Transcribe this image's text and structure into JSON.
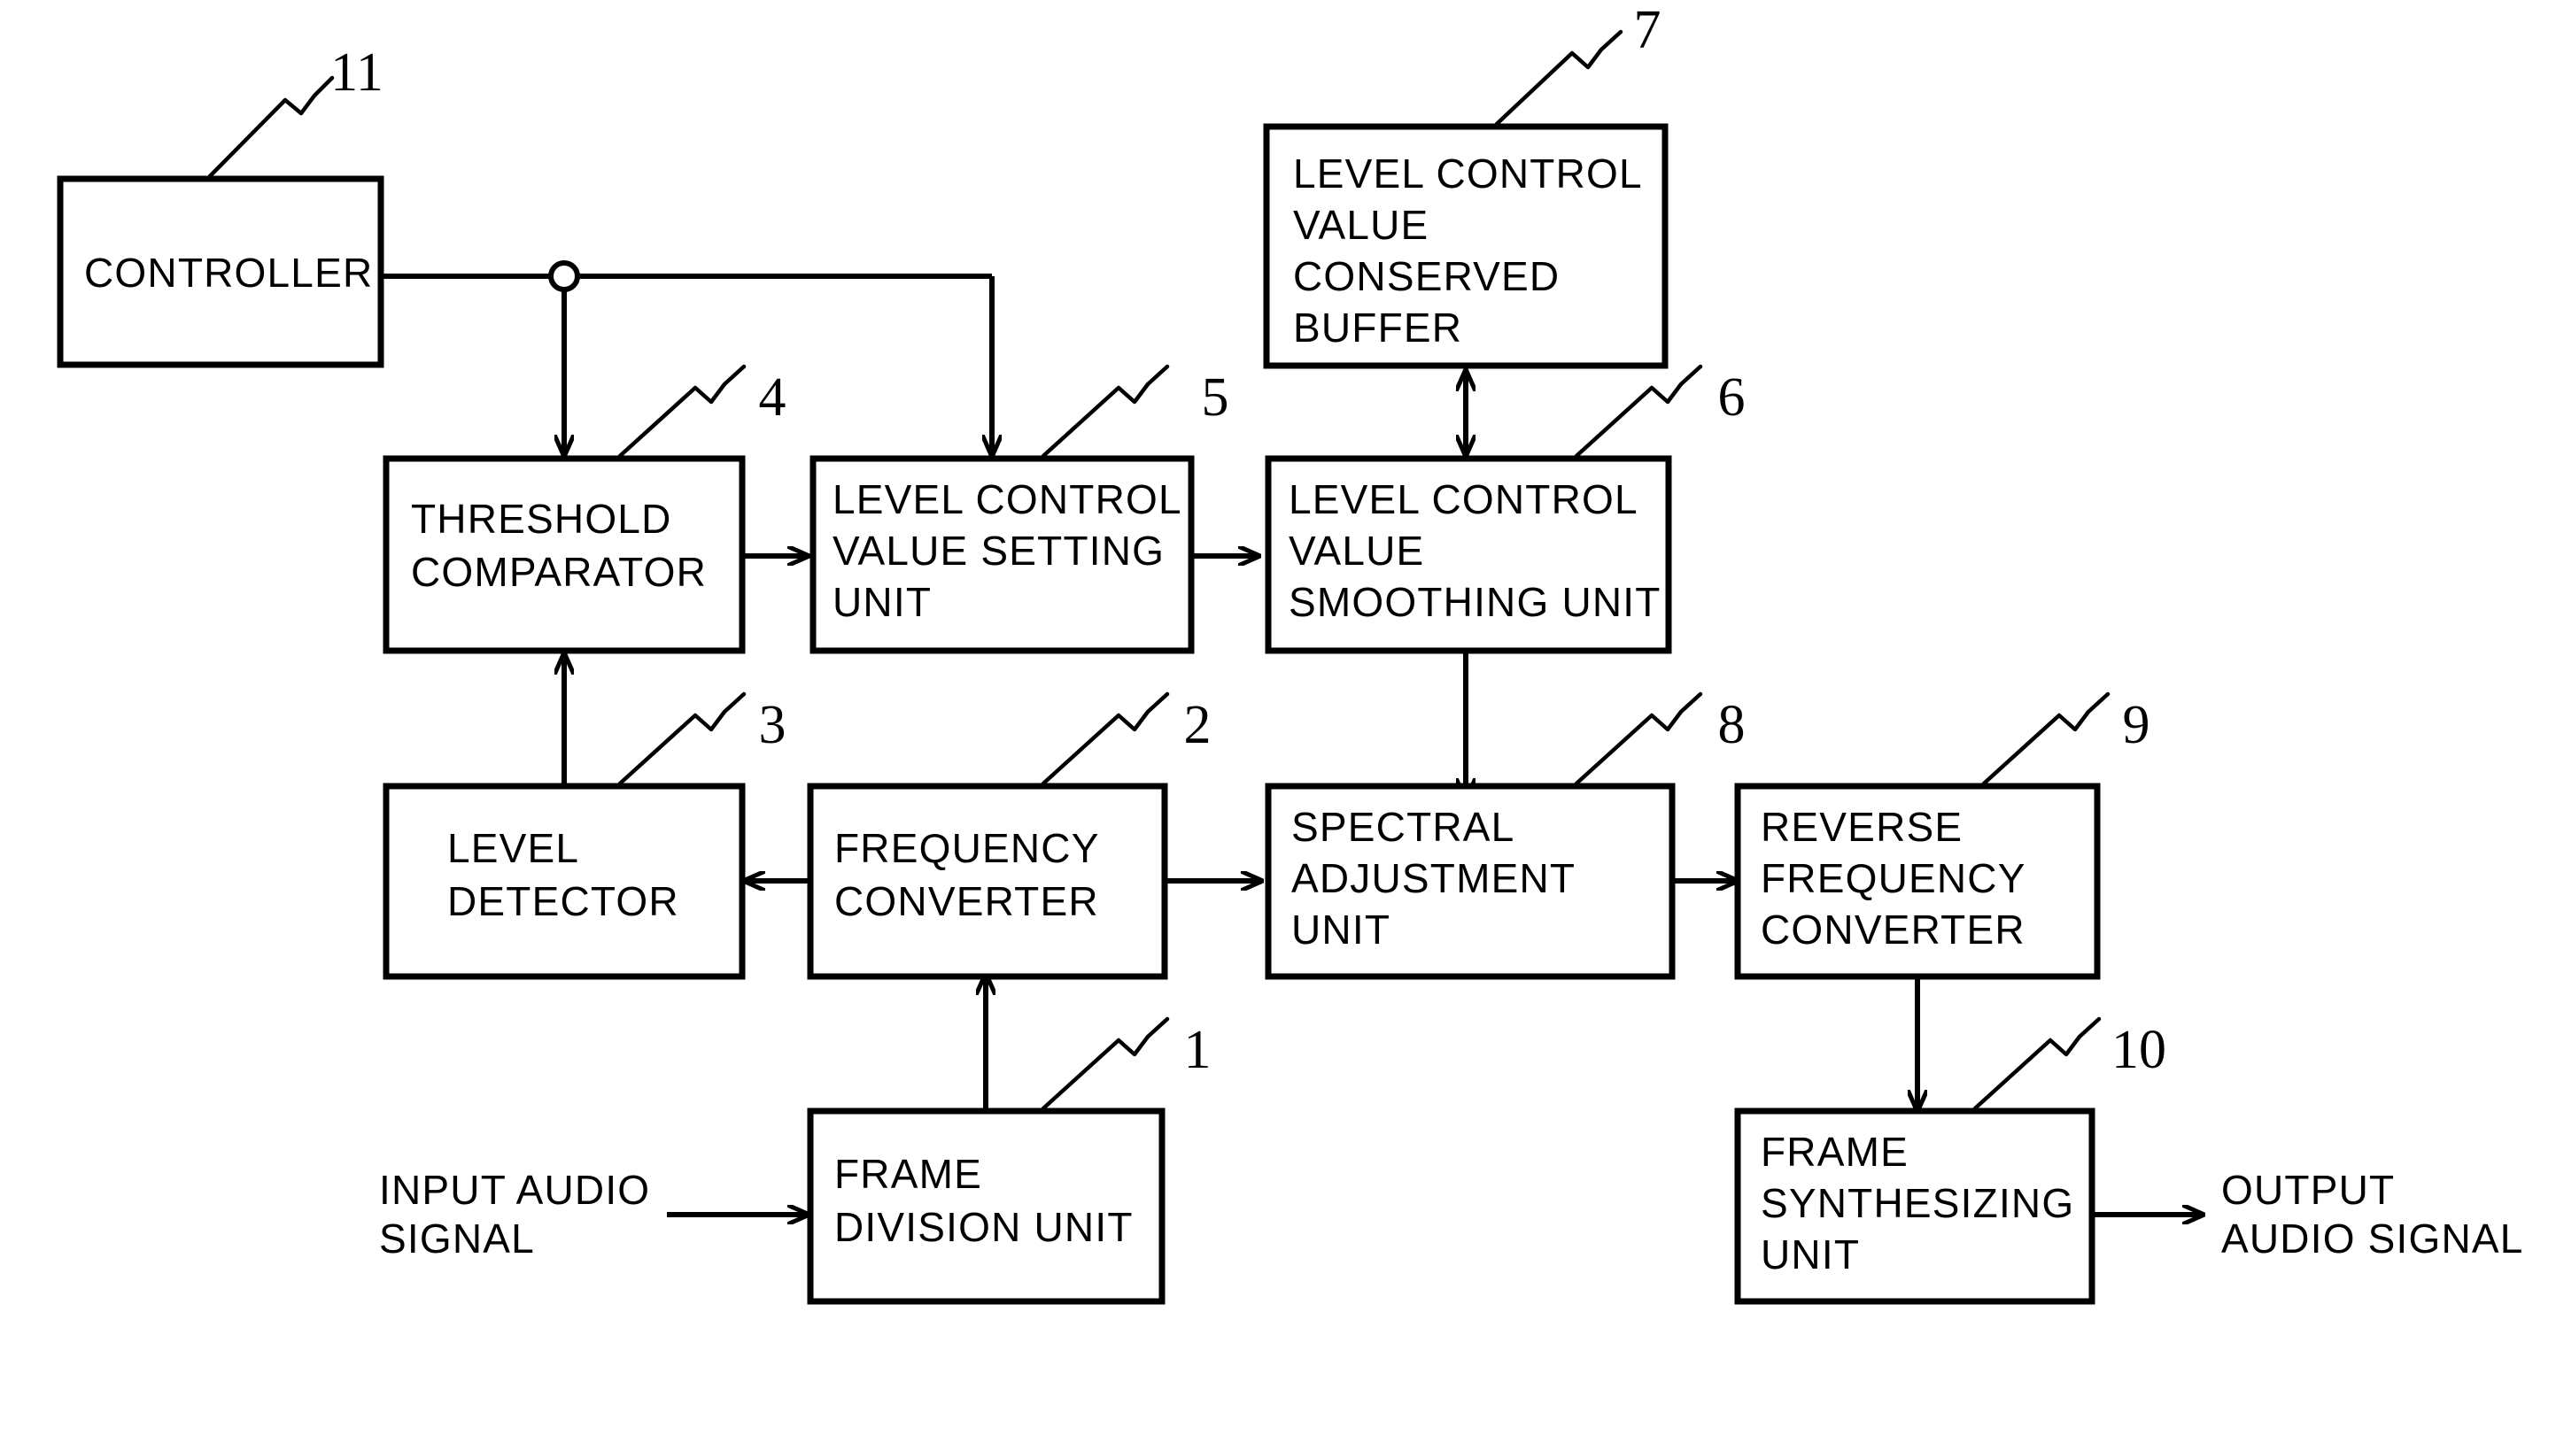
{
  "figure": {
    "kind": "patent-block-diagram",
    "stroke_color": "#000000",
    "fill_color": "#ffffff",
    "background": "#ffffff"
  },
  "blocks": {
    "frame_division": {
      "ref": "1",
      "lines": [
        "FRAME",
        "DIVISION  UNIT"
      ]
    },
    "frequency_converter": {
      "ref": "2",
      "lines": [
        "FREQUENCY",
        "CONVERTER"
      ]
    },
    "level_detector": {
      "ref": "3",
      "lines": [
        "LEVEL",
        "DETECTOR"
      ]
    },
    "threshold_comparator": {
      "ref": "4",
      "lines": [
        "THRESHOLD",
        "COMPARATOR"
      ]
    },
    "level_control_value_setting": {
      "ref": "5",
      "lines": [
        "LEVEL  CONTROL",
        "VALUE  SETTING",
        "UNIT"
      ]
    },
    "level_control_value_smoothing": {
      "ref": "6",
      "lines": [
        "LEVEL  CONTROL",
        "VALUE",
        "SMOOTHING UNIT"
      ]
    },
    "level_control_value_buffer": {
      "ref": "7",
      "lines": [
        "LEVEL  CONTROL",
        "VALUE",
        "CONSERVED",
        "BUFFER"
      ]
    },
    "spectral_adjustment": {
      "ref": "8",
      "lines": [
        "SPECTRAL",
        "ADJUSTMENT",
        "UNIT"
      ]
    },
    "reverse_frequency_converter": {
      "ref": "9",
      "lines": [
        "REVERSE",
        "FREQUENCY",
        "CONVERTER"
      ]
    },
    "frame_synthesizing": {
      "ref": "10",
      "lines": [
        "FRAME",
        "SYNTHESIZING",
        "UNIT"
      ]
    },
    "controller": {
      "ref": "11",
      "lines": [
        "CONTROLLER"
      ]
    }
  },
  "io_labels": {
    "input_signal": {
      "lines": [
        "INPUT AUDIO",
        "SIGNAL"
      ]
    },
    "output_signal": {
      "lines": [
        "OUTPUT",
        "AUDIO SIGNAL"
      ]
    }
  }
}
